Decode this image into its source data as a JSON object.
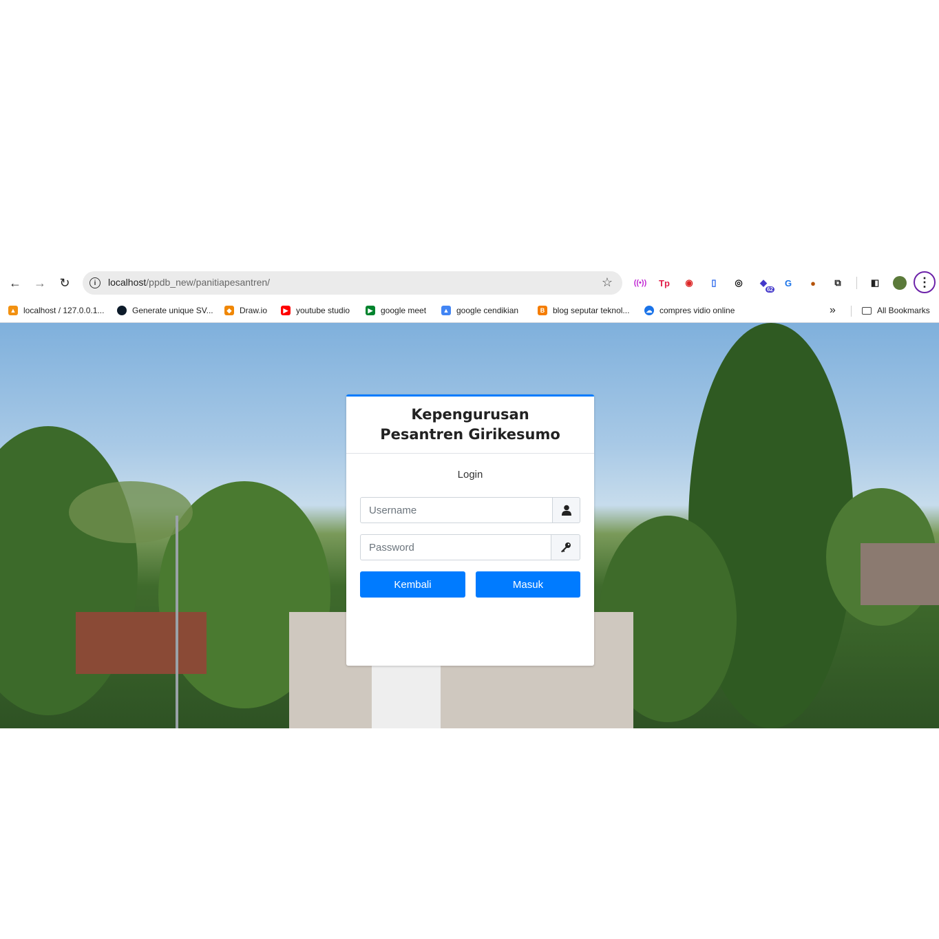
{
  "browser": {
    "nav": {
      "back_icon": "←",
      "forward_icon": "→",
      "reload_icon": "↻"
    },
    "address": {
      "host": "localhost",
      "path": "/ppdb_new/panitiapesantren/"
    },
    "extension_badge": "62",
    "bookmarks": [
      {
        "label": "localhost / 127.0.0.1...",
        "icon": "pma-icon",
        "color": "#f29111"
      },
      {
        "label": "Generate unique SV...",
        "icon": "circle-icon",
        "color": "#0d1b2a"
      },
      {
        "label": "Draw.io",
        "icon": "drawio-icon",
        "color": "#f08705"
      },
      {
        "label": "youtube studio",
        "icon": "youtube-icon",
        "color": "#ff0000"
      },
      {
        "label": "google meet",
        "icon": "meet-icon",
        "color": "#00832d"
      },
      {
        "label": "google cendikian",
        "icon": "scholar-icon",
        "color": "#4285f4"
      },
      {
        "label": "blog seputar teknol...",
        "icon": "blogger-icon",
        "color": "#f57d00"
      },
      {
        "label": "compres vidio online",
        "icon": "cloud-icon",
        "color": "#1a73e8"
      }
    ],
    "more_bookmarks": "»",
    "all_bookmarks": "All Bookmarks"
  },
  "login": {
    "title_line1": "Kepengurusan",
    "title_line2": "Pesantren Girikesumo",
    "message": "Login",
    "username_placeholder": "Username",
    "password_placeholder": "Password",
    "back_label": "Kembali",
    "submit_label": "Masuk",
    "accent": "#007bff"
  }
}
